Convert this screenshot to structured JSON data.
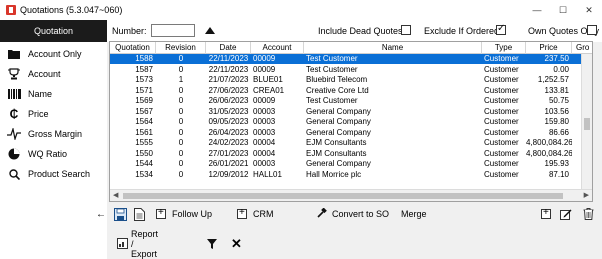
{
  "window": {
    "title": "Quotations (5.3.047~060)",
    "controls": {
      "minimize": "—",
      "maximize": "☐",
      "close": "✕"
    }
  },
  "sidebar": {
    "items": [
      {
        "label": "Quotation",
        "icon": "none",
        "active": true
      },
      {
        "label": "Account Only",
        "icon": "folder-icon"
      },
      {
        "label": "Account",
        "icon": "trophy-icon"
      },
      {
        "label": "Name",
        "icon": "barcode-icon"
      },
      {
        "label": "Price",
        "icon": "pound-icon"
      },
      {
        "label": "Gross Margin",
        "icon": "pulse-icon"
      },
      {
        "label": "WQ Ratio",
        "icon": "pie-chart-icon"
      },
      {
        "label": "Product Search",
        "icon": "search-icon"
      }
    ]
  },
  "filters": {
    "number_label": "Number:",
    "number_value": "",
    "include_dead_label": "Include Dead Quotes",
    "include_dead_checked": false,
    "exclude_ordered_label": "Exclude If Ordered",
    "exclude_ordered_checked": true,
    "own_only_label": "Own Quotes Only",
    "own_only_checked": false
  },
  "table": {
    "columns": [
      "Quotation",
      "Revision",
      "Date",
      "Account",
      "Name",
      "Type",
      "Price",
      "Gro"
    ],
    "rows": [
      {
        "quotation": "1588",
        "revision": "0",
        "date": "22/11/2023",
        "account": "00009",
        "name": "Test Customer",
        "type": "Customer",
        "price": "237.50",
        "selected": true
      },
      {
        "quotation": "1587",
        "revision": "0",
        "date": "22/11/2023",
        "account": "00009",
        "name": "Test Customer",
        "type": "Customer",
        "price": "0.00"
      },
      {
        "quotation": "1573",
        "revision": "1",
        "date": "21/07/2023",
        "account": "BLUE01",
        "name": "Bluebird Telecom",
        "type": "Customer",
        "price": "1,252.57"
      },
      {
        "quotation": "1571",
        "revision": "0",
        "date": "27/06/2023",
        "account": "CREA01",
        "name": "Creative Core Ltd",
        "type": "Customer",
        "price": "133.81"
      },
      {
        "quotation": "1569",
        "revision": "0",
        "date": "26/06/2023",
        "account": "00009",
        "name": "Test Customer",
        "type": "Customer",
        "price": "50.75"
      },
      {
        "quotation": "1567",
        "revision": "0",
        "date": "31/05/2023",
        "account": "00003",
        "name": "General Company",
        "type": "Customer",
        "price": "103.56"
      },
      {
        "quotation": "1564",
        "revision": "0",
        "date": "09/05/2023",
        "account": "00003",
        "name": "General Company",
        "type": "Customer",
        "price": "159.80"
      },
      {
        "quotation": "1561",
        "revision": "0",
        "date": "26/04/2023",
        "account": "00003",
        "name": "General Company",
        "type": "Customer",
        "price": "86.66"
      },
      {
        "quotation": "1555",
        "revision": "0",
        "date": "24/02/2023",
        "account": "00004",
        "name": "EJM Consultants",
        "type": "Customer",
        "price": "4,800,084.26"
      },
      {
        "quotation": "1550",
        "revision": "0",
        "date": "27/01/2023",
        "account": "00004",
        "name": "EJM Consultants",
        "type": "Customer",
        "price": "4,800,084.26"
      },
      {
        "quotation": "1544",
        "revision": "0",
        "date": "26/01/2021",
        "account": "00003",
        "name": "General Company",
        "type": "Customer",
        "price": "195.93"
      },
      {
        "quotation": "1534",
        "revision": "0",
        "date": "12/09/2012",
        "account": "HALL01",
        "name": "Hall Morrice plc",
        "type": "Customer",
        "price": "87.10"
      }
    ]
  },
  "toolbar": {
    "follow_up": "Follow Up",
    "crm": "CRM",
    "convert_to_so": "Convert to SO",
    "merge": "Merge",
    "report_export": "Report / Export"
  },
  "colors": {
    "selection": "#0a6fd6",
    "sidebar_active": "#1b1b1b"
  }
}
